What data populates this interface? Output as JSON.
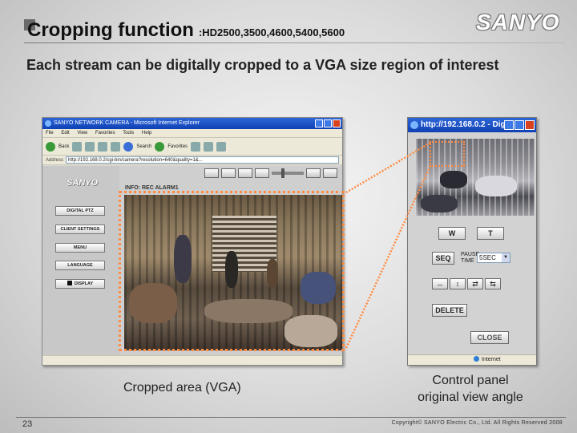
{
  "slide": {
    "title": "Cropping function",
    "models": ":HD2500,3500,4600,5400,5600",
    "logo": "SANYO",
    "subtitle": "Each stream can be digitally cropped to a VGA size region of interest",
    "caption_left": "Cropped area (VGA)",
    "caption_right_line1": "Control panel",
    "caption_right_line2": "original view angle",
    "page_number": "23",
    "copyright": "Copyright© SANYO Electric Co., Ltd. All Rights Reserved 2008"
  },
  "browser": {
    "title": "SANYO NETWORK CAMERA - Microsoft Internet Explorer",
    "menu": [
      "File",
      "Edit",
      "View",
      "Favorites",
      "Tools",
      "Help"
    ],
    "toolbar_back": "Back",
    "toolbar_search": "Search",
    "toolbar_favorites": "Favorites",
    "address_label": "Address",
    "address_url": "http://192.168.0.2/cgi-bin/camera?resolution=640&quality=1&...",
    "page_logo": "SANYO",
    "info_line": "INFO: REC   ALARM1",
    "side_buttons": [
      "DIGITAL PTZ",
      "CLIENT SETTINGS",
      "MENU",
      "LANGUAGE",
      "DISPLAY"
    ]
  },
  "popup": {
    "title": "http://192.168.0.2 - Dig...",
    "btn_w": "W",
    "btn_t": "T",
    "btn_seq": "SEQ",
    "pause_label_1": "PAUSE",
    "pause_label_2": "TIME",
    "pause_value": "5SEC",
    "arrows": [
      "↔",
      "↕",
      "⇄",
      "⇆"
    ],
    "btn_delete": "DELETE",
    "btn_close": "CLOSE",
    "status": "Internet"
  },
  "colors": {
    "crop_outline": "#ff8c42",
    "titlebar": "#1f52c8"
  }
}
